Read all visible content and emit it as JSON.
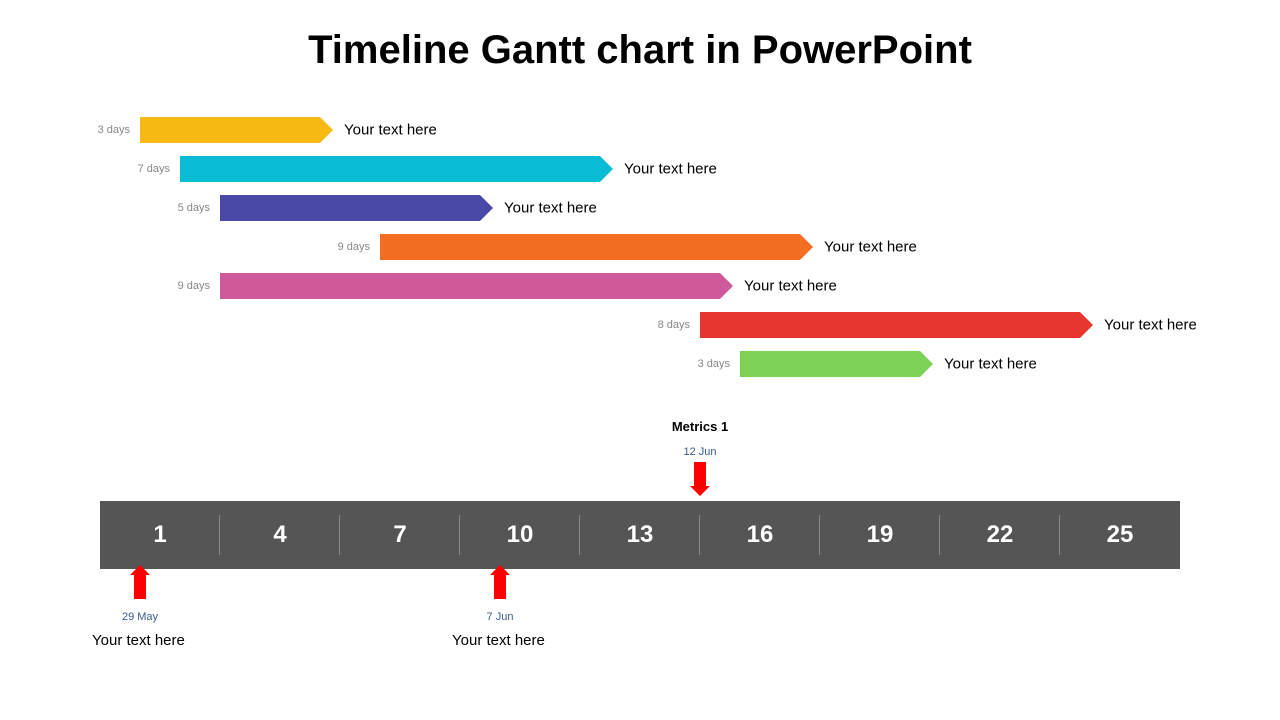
{
  "title": "Timeline Gantt chart in PowerPoint",
  "chart_data": {
    "type": "bar",
    "title": "Timeline Gantt chart in PowerPoint",
    "axis_ticks": [
      1,
      4,
      7,
      10,
      13,
      16,
      19,
      22,
      25
    ],
    "tasks": [
      {
        "start": 1,
        "duration": 3,
        "color": "#F7B913",
        "duration_label": "3 days",
        "label": "Your text here"
      },
      {
        "start": 2,
        "duration": 7,
        "color": "#09BBD3",
        "duration_label": "7 days",
        "label": "Your text here"
      },
      {
        "start": 3,
        "duration": 5,
        "color": "#4A49A8",
        "duration_label": "5 days",
        "label": "Your text here"
      },
      {
        "start": 7,
        "duration": 9,
        "color": "#F36E23",
        "duration_label": "9 days",
        "label": "Your text here"
      },
      {
        "start": 3,
        "duration": 9,
        "color": "#CE5A9C",
        "duration_label": "9 days",
        "label": "Your text here"
      },
      {
        "start": 15,
        "duration": 8,
        "color": "#E7352F",
        "duration_label": "8 days",
        "label": "Your text here"
      },
      {
        "start": 16,
        "duration": 3,
        "color": "#7ED156",
        "duration_label": "3 days",
        "label": "Your text here"
      }
    ],
    "markers": [
      {
        "position": 16,
        "date": "12 Jun",
        "label": "Metrics 1",
        "side": "top"
      },
      {
        "position": 1,
        "date": "29 May",
        "label": "Your text here",
        "side": "bottom"
      },
      {
        "position": 10,
        "date": "7 Jun",
        "label": "Your text here",
        "side": "bottom"
      }
    ]
  },
  "axis": {
    "t0": "1",
    "t1": "4",
    "t2": "7",
    "t3": "10",
    "t4": "13",
    "t5": "16",
    "t6": "19",
    "t7": "22",
    "t8": "25"
  },
  "tasks": {
    "d0": "3 days",
    "l0": "Your text here",
    "d1": "7 days",
    "l1": "Your text here",
    "d2": "5 days",
    "l2": "Your text here",
    "d3": "9 days",
    "l3": "Your text here",
    "d4": "9 days",
    "l4": "Your text here",
    "d5": "8 days",
    "l5": "Your text here",
    "d6": "3 days",
    "l6": "Your text here"
  },
  "markers": {
    "metrics": "Metrics 1",
    "top_date": "12 Jun",
    "b1_date": "29 May",
    "b1_label": "Your text here",
    "b2_date": "7 Jun",
    "b2_label": "Your text here"
  }
}
